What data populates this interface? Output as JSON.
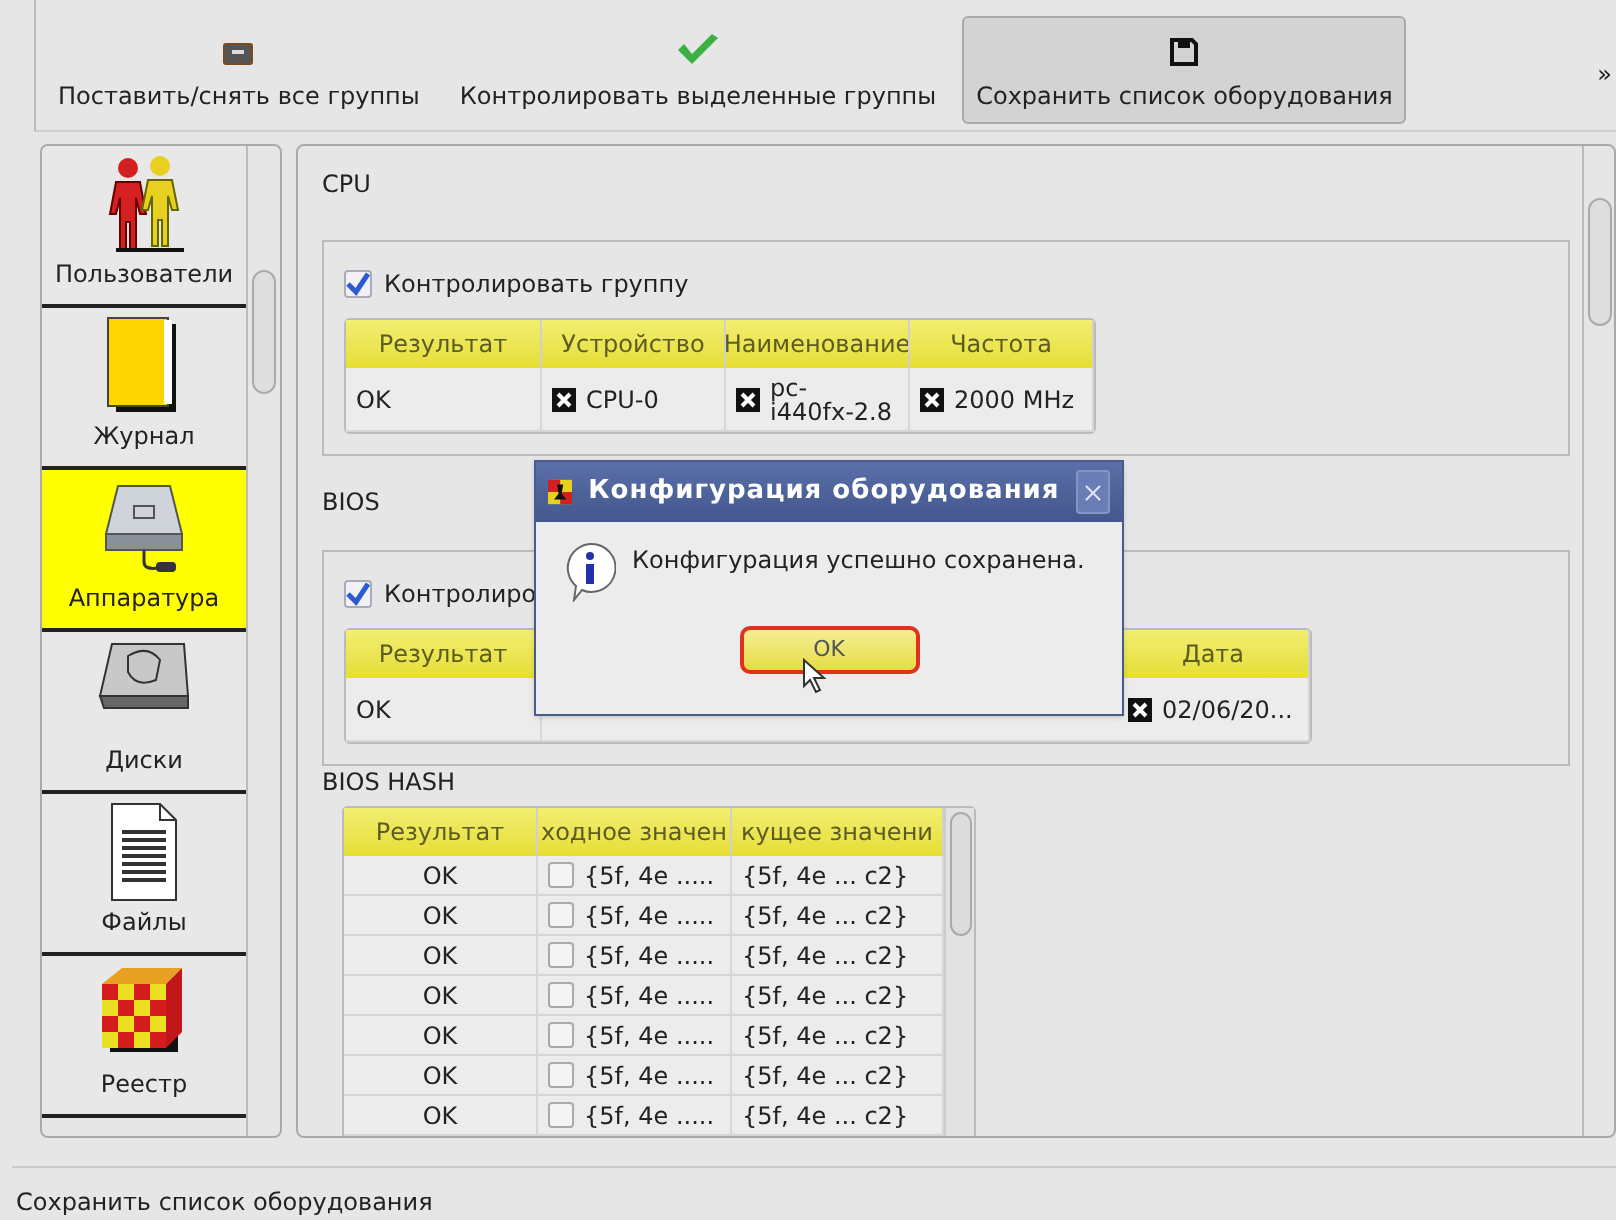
{
  "toolbar": {
    "buttons": [
      {
        "label": "Поставить/снять все группы",
        "selected": false
      },
      {
        "label": "Контролировать выделенные группы",
        "selected": false
      },
      {
        "label": "Сохранить список оборудования",
        "selected": true
      }
    ],
    "overflow": "»"
  },
  "sidebar": {
    "items": [
      {
        "label": "Пользователи",
        "selected": false
      },
      {
        "label": "Журнал",
        "selected": false
      },
      {
        "label": "Аппаратура",
        "selected": true
      },
      {
        "label": "Диски",
        "selected": false
      },
      {
        "label": "Файлы",
        "selected": false
      },
      {
        "label": "Реестр",
        "selected": false
      }
    ]
  },
  "sections": [
    {
      "kind": "group",
      "title": "CPU",
      "control": {
        "label": "Контролировать группу",
        "checked": true
      },
      "table": {
        "columns": [
          "Результат",
          "Устройство",
          "Наименование",
          "Частота"
        ],
        "rows": [
          {
            "cells": [
              {
                "text": "OK"
              },
              {
                "text": "CPU-0",
                "checked": true
              },
              {
                "text": "pc-\ni440fx-2.8",
                "checked": true
              },
              {
                "text": "2000 MHz",
                "checked": true
              }
            ]
          }
        ]
      }
    },
    {
      "kind": "covered",
      "title": "BIOS",
      "control": {
        "label": "Контролиро",
        "checked": true
      },
      "table": {
        "columns": [
          "Результат",
          "Дата"
        ],
        "rows": [
          {
            "cells": [
              {
                "text": "OK"
              },
              {
                "text": "02/06/20...",
                "checked": true
              }
            ]
          }
        ]
      }
    },
    {
      "kind": "list",
      "title": "BIOS HASH",
      "table": {
        "columns": [
          "Результат",
          "ходное значен",
          "кущее значени"
        ],
        "rows": [
          {
            "cells": [
              {
                "text": "OK"
              },
              {
                "text": "{5f, 4e .....",
                "checked": false
              },
              {
                "text": "{5f, 4e ... c2}"
              }
            ]
          },
          {
            "cells": [
              {
                "text": "OK"
              },
              {
                "text": "{5f, 4e .....",
                "checked": false
              },
              {
                "text": "{5f, 4e ... c2}"
              }
            ]
          },
          {
            "cells": [
              {
                "text": "OK"
              },
              {
                "text": "{5f, 4e .....",
                "checked": false
              },
              {
                "text": "{5f, 4e ... c2}"
              }
            ]
          },
          {
            "cells": [
              {
                "text": "OK"
              },
              {
                "text": "{5f, 4e .....",
                "checked": false
              },
              {
                "text": "{5f, 4e ... c2}"
              }
            ]
          },
          {
            "cells": [
              {
                "text": "OK"
              },
              {
                "text": "{5f, 4e .....",
                "checked": false
              },
              {
                "text": "{5f, 4e ... c2}"
              }
            ]
          },
          {
            "cells": [
              {
                "text": "OK"
              },
              {
                "text": "{5f, 4e .....",
                "checked": false
              },
              {
                "text": "{5f, 4e ... c2}"
              }
            ]
          },
          {
            "cells": [
              {
                "text": "OK"
              },
              {
                "text": "{5f, 4e .....",
                "checked": false
              },
              {
                "text": "{5f, 4e ... c2}"
              }
            ]
          }
        ]
      }
    }
  ],
  "dialog": {
    "title": "Конфигурация оборудования",
    "message": "Конфигурация успешно сохранена.",
    "button": "OK"
  },
  "status_bar": {
    "text": "Сохранить список оборудования"
  }
}
